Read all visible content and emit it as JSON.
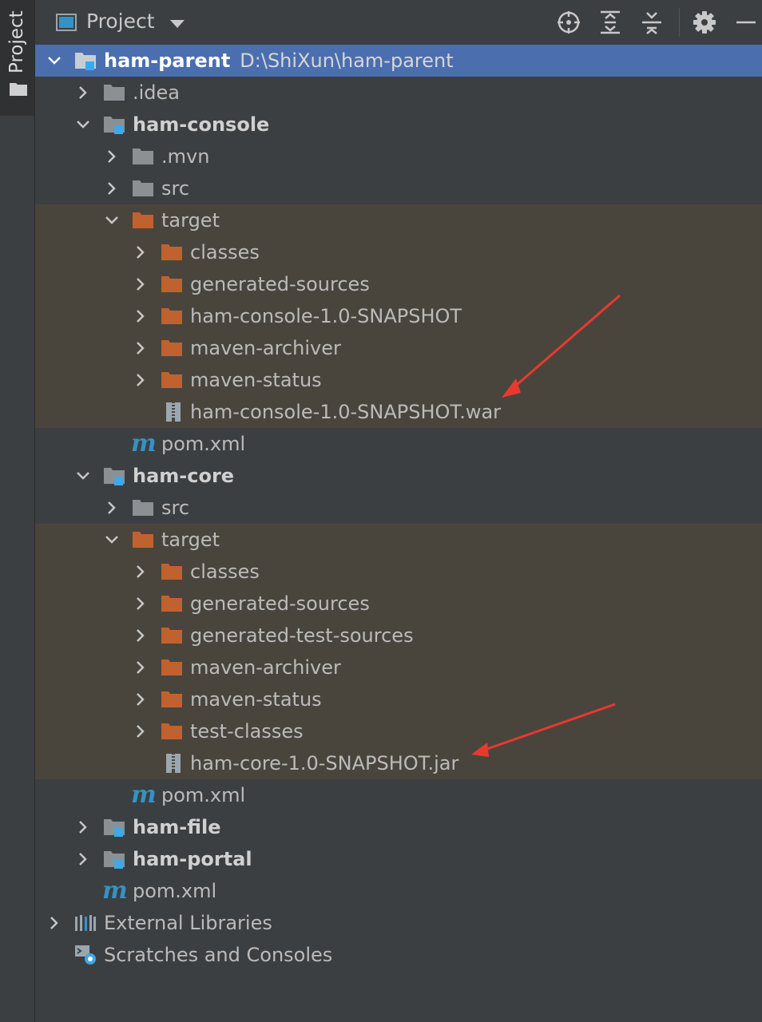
{
  "side_strip": {
    "tab_label": "Project",
    "tab_icon": "folder-icon"
  },
  "header": {
    "title": "Project",
    "title_icon": "project-view-icon",
    "dropdown_icon": "caret-down-icon",
    "buttons": [
      "locate-icon",
      "expand-all-icon",
      "collapse-all-icon",
      "gear-icon",
      "minimize-icon"
    ]
  },
  "tree": {
    "root": {
      "name": "ham-parent",
      "path": "D:\\ShiXun\\ham-parent"
    },
    "idea": ".idea",
    "console": {
      "name": "ham-console",
      "mvn": ".mvn",
      "src": "src",
      "target": "target",
      "target_children": [
        "classes",
        "generated-sources",
        "ham-console-1.0-SNAPSHOT",
        "maven-archiver",
        "maven-status"
      ],
      "artifact": "ham-console-1.0-SNAPSHOT.war",
      "pom": "pom.xml"
    },
    "core": {
      "name": "ham-core",
      "src": "src",
      "target": "target",
      "target_children": [
        "classes",
        "generated-sources",
        "generated-test-sources",
        "maven-archiver",
        "maven-status",
        "test-classes"
      ],
      "artifact": "ham-core-1.0-SNAPSHOT.jar",
      "pom": "pom.xml"
    },
    "file": "ham-file",
    "portal": "ham-portal",
    "root_pom": "pom.xml",
    "external_libraries": "External Libraries",
    "scratches": "Scratches and Consoles",
    "maven_glyph": "m"
  },
  "colors": {
    "selection": "#4b6eaf",
    "excluded_bg": "#4a453c",
    "excluded_folder": "#c0622f",
    "folder": "#8b9094",
    "module_badge": "#3fa8e8",
    "annotation_arrow": "#e8392f"
  }
}
